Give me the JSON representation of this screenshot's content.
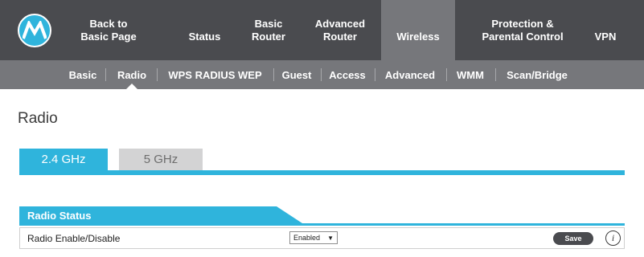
{
  "brand": {
    "logo_icon": "motorola-batwing-icon",
    "accent_color": "#2fb4dc",
    "nav_bg": "#4a4b4f",
    "active_bg": "#76777b"
  },
  "topnav": {
    "items": [
      {
        "line1": "Back to",
        "line2": "Basic Page"
      },
      {
        "line1": "",
        "line2": "Status"
      },
      {
        "line1": "Basic",
        "line2": "Router"
      },
      {
        "line1": "Advanced",
        "line2": "Router"
      },
      {
        "line1": "",
        "line2": "Wireless"
      },
      {
        "line1": "Protection &",
        "line2": "Parental Control"
      },
      {
        "line1": "",
        "line2": "VPN"
      }
    ],
    "active": "Wireless"
  },
  "subnav": {
    "items": [
      "Basic",
      "Radio",
      "WPS RADIUS WEP",
      "Guest",
      "Access",
      "Advanced",
      "WMM",
      "Scan/Bridge"
    ],
    "active": "Radio"
  },
  "page": {
    "title": "Radio"
  },
  "tabs": {
    "items": [
      "2.4 GHz",
      "5 GHz"
    ],
    "active": "2.4 GHz"
  },
  "section": {
    "title": "Radio Status",
    "rows": [
      {
        "label": "Radio Enable/Disable",
        "select_value": "Enabled",
        "save_label": "Save",
        "info_icon": "info-icon",
        "info_glyph": "i"
      }
    ]
  }
}
